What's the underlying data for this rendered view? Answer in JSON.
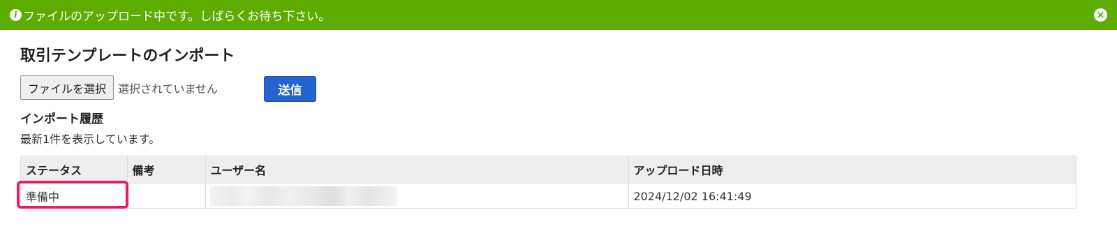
{
  "alert": {
    "icon": "info-icon",
    "message": "ファイルのアップロード中です。しばらくお待ち下さい。",
    "close_icon": "close-icon",
    "color": "#5cad00"
  },
  "page": {
    "title": "取引テンプレートのインポート"
  },
  "file_input": {
    "button_label": "ファイルを選択",
    "status_text": "選択されていません"
  },
  "submit": {
    "label": "送信",
    "color": "#2563d3"
  },
  "history": {
    "title": "インポート履歴",
    "description": "最新1件を表示しています。",
    "columns": [
      "ステータス",
      "備考",
      "ユーザー名",
      "アップロード日時"
    ],
    "rows": [
      {
        "status": "準備中",
        "note": "",
        "username": "",
        "uploaded_at": "2024/12/02 16:41:49"
      }
    ]
  },
  "highlight_color": "#f0186a"
}
